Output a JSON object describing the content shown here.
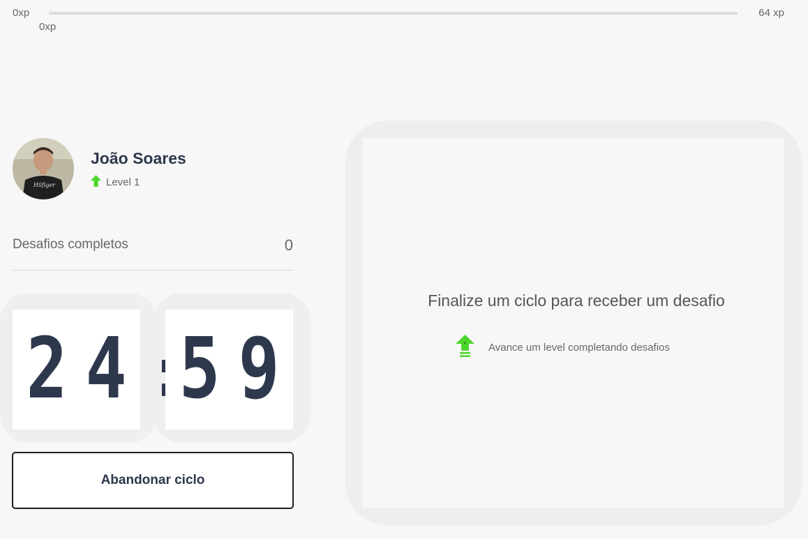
{
  "xp": {
    "start_label": "0xp",
    "end_label": "64 xp",
    "current_label": "0xp",
    "progress_fraction": 0,
    "fill_color": "#4cd62b"
  },
  "profile": {
    "name": "João Soares",
    "level_label": "Level 1",
    "level_icon": "level-up-arrow-icon",
    "avatar_icon": "user-photo"
  },
  "challenges": {
    "completed_label": "Desafios completos",
    "completed_count": "0"
  },
  "countdown": {
    "minute_left": "2",
    "minute_right": "4",
    "separator": ":",
    "second_left": "5",
    "second_right": "9"
  },
  "actions": {
    "abandon_label": "Abandonar ciclo"
  },
  "challenge_panel": {
    "title": "Finalize um ciclo para receber um desafio",
    "hint": "Avance um level completando desafios",
    "hint_icon": "level-up-icon"
  },
  "colors": {
    "accent_green": "#4cd62b",
    "text_dark": "#2e384d",
    "background": "#f7f7f8"
  }
}
